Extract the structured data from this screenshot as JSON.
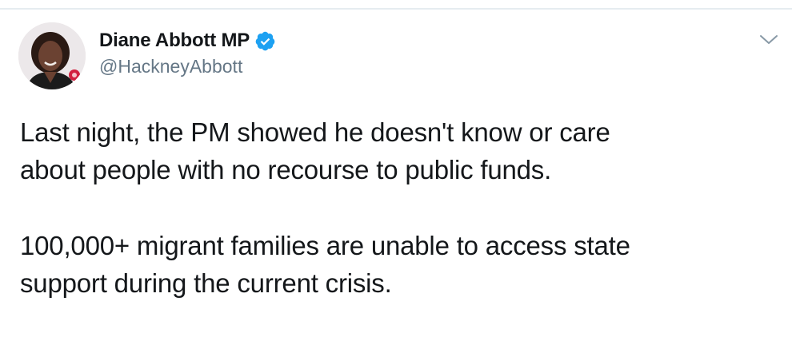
{
  "tweet": {
    "author": {
      "display_name": "Diane Abbott MP",
      "handle": "@HackneyAbbott",
      "verified": true
    },
    "paragraphs": [
      {
        "lines": [
          "Last night, the PM showed he doesn't know or care",
          "about people with no recourse to public funds."
        ]
      },
      {
        "lines": [
          "100,000+ migrant families are unable to access state",
          "support during the current crisis."
        ]
      }
    ]
  },
  "icons": {
    "verified": "verified-badge-icon",
    "menu": "chevron-down-icon"
  },
  "colors": {
    "text_primary": "#14171a",
    "text_secondary": "#657786",
    "verified_blue": "#1da1f2",
    "divider": "#e6ecf0"
  }
}
